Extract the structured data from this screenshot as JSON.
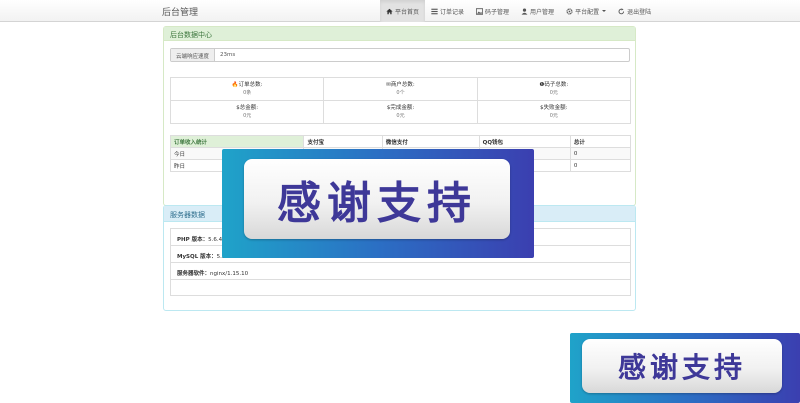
{
  "navbar": {
    "brand": "后台管理",
    "items": [
      {
        "label": "平台首页",
        "icon": "home-icon",
        "active": true
      },
      {
        "label": "订单记录",
        "icon": "list-icon"
      },
      {
        "label": "码子管理",
        "icon": "image-icon"
      },
      {
        "label": "用户管理",
        "icon": "user-icon"
      },
      {
        "label": "平台配置",
        "icon": "gear-icon"
      },
      {
        "label": "退出登陆",
        "icon": "logout-icon"
      }
    ]
  },
  "data_center": {
    "title": "后台数据中心",
    "speed_label": "云端响应速度",
    "speed_value": "23ms",
    "stats": [
      {
        "label": "订单总数:",
        "value": "0条",
        "icon": "fire-icon"
      },
      {
        "label": "商户总数:",
        "value": "0个",
        "icon": "paper-icon"
      },
      {
        "label": "码子总数:",
        "value": "0元",
        "icon": "info-icon"
      },
      {
        "label": "总金额:",
        "value": "0元",
        "icon": "dollar-icon"
      },
      {
        "label": "完成金额:",
        "value": "0元",
        "icon": "dollar-icon"
      },
      {
        "label": "失败金额:",
        "value": "0元",
        "icon": "dollar-icon"
      }
    ],
    "revenue": {
      "headers": [
        "订单收入统计",
        "支付宝",
        "微信支付",
        "QQ钱包",
        "总计"
      ],
      "rows": [
        [
          "今日",
          "",
          "",
          "",
          "0"
        ],
        [
          "昨日",
          "",
          "",
          "",
          "0"
        ]
      ]
    }
  },
  "server": {
    "title": "服务器数据",
    "rows": [
      {
        "label": "PHP 版本：",
        "value": "5.6.40"
      },
      {
        "label": "MySQL 版本：",
        "value": "5.5"
      },
      {
        "label": "服务器软件：",
        "value": "nginx/1.15.10"
      }
    ]
  },
  "overlay": {
    "text": "感谢支持"
  },
  "colors": {
    "success_bg": "#dff0d8",
    "info_bg": "#d9edf7",
    "banner_text": "#3e3898"
  }
}
